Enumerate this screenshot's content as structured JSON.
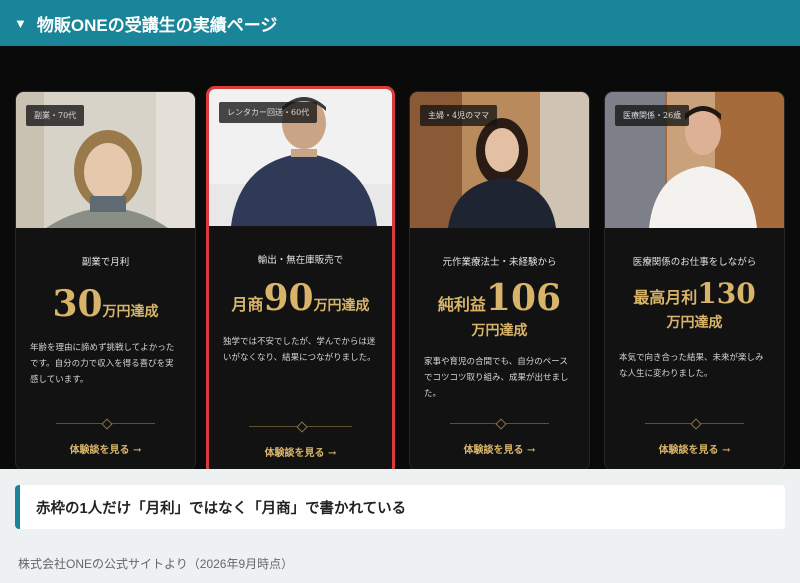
{
  "header": {
    "title": "物販ONEの受講生の実績ページ"
  },
  "cards": [
    {
      "tag": "副業・70代",
      "lead": "副業で月利",
      "prefix": "",
      "number": "30",
      "suffix": "万円達成",
      "sub": "",
      "text": "年齢を理由に諦めず挑戦してよかったです。自分の力で収入を得る喜びを実感しています。",
      "cta": "体験談を見る →"
    },
    {
      "tag": "レンタカー回送・60代",
      "lead": "輸出・無在庫販売で",
      "prefix": "月商",
      "number": "90",
      "suffix": "万円達成",
      "sub": "",
      "text": "独学では不安でしたが、学んでからは迷いがなくなり、結果につながりました。",
      "cta": "体験談を見る →"
    },
    {
      "tag": "主婦・4児のママ",
      "lead": "元作業療法士・未経験から",
      "prefix": "純利益",
      "number": "106",
      "suffix": "",
      "sub": "万円達成",
      "text": "家事や育児の合間でも、自分のペースでコツコツ取り組み、成果が出せました。",
      "cta": "体験談を見る →"
    },
    {
      "tag": "医療関係・26歳",
      "lead": "医療関係のお仕事をしながら",
      "prefix": "最高月利",
      "number": "130",
      "suffix": "",
      "sub": "万円達成",
      "text": "本気で向き合った結果、未来が楽しみな人生に変わりました。",
      "cta": "体験談を見る →"
    }
  ],
  "note": "赤枠の1人だけ「月利」ではなく「月商」で書かれている",
  "source": "株式会社ONEの公式サイトより（2026年9月時点）",
  "colors": {
    "header": "#1a8599",
    "gold": "#d7b46a",
    "highlight": "#d93a3a"
  }
}
